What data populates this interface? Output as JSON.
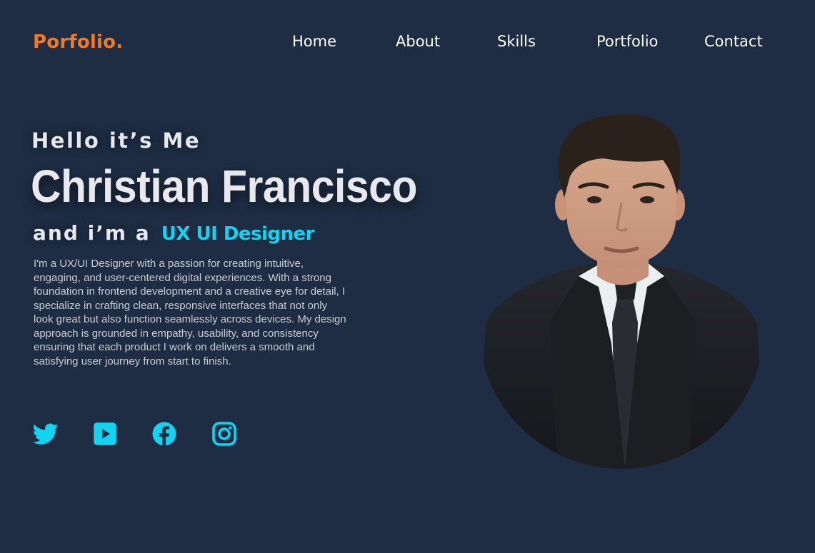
{
  "header": {
    "logo": "Porfolio.",
    "nav": [
      {
        "label": "Home"
      },
      {
        "label": "About"
      },
      {
        "label": "Skills"
      },
      {
        "label": "Portfolio"
      },
      {
        "label": "Contact"
      }
    ]
  },
  "hero": {
    "greeting": "Hello it’s Me",
    "name": "Christian Francisco",
    "role_prefix": "and i’m a",
    "role_title": "UX UI Designer",
    "bio": "I'm a UX/UI Designer with a passion for creating intuitive, engaging, and user-centered digital experiences. With a strong foundation in frontend development and a creative eye for detail, I specialize in crafting clean, responsive interfaces that not only look great but also function seamlessly across devices. My design approach is grounded in empathy, usability, and consistency ensuring that each product I work on delivers a smooth and satisfying user journey from start to finish."
  },
  "socials": [
    {
      "icon": "twitter-icon"
    },
    {
      "icon": "youtube-icon"
    },
    {
      "icon": "facebook-icon"
    },
    {
      "icon": "instagram-icon"
    }
  ],
  "colors": {
    "background": "#1e2d44",
    "accent_orange": "#f47a1f",
    "accent_cyan": "#12d3f0",
    "text_light": "#e6e8ee"
  }
}
